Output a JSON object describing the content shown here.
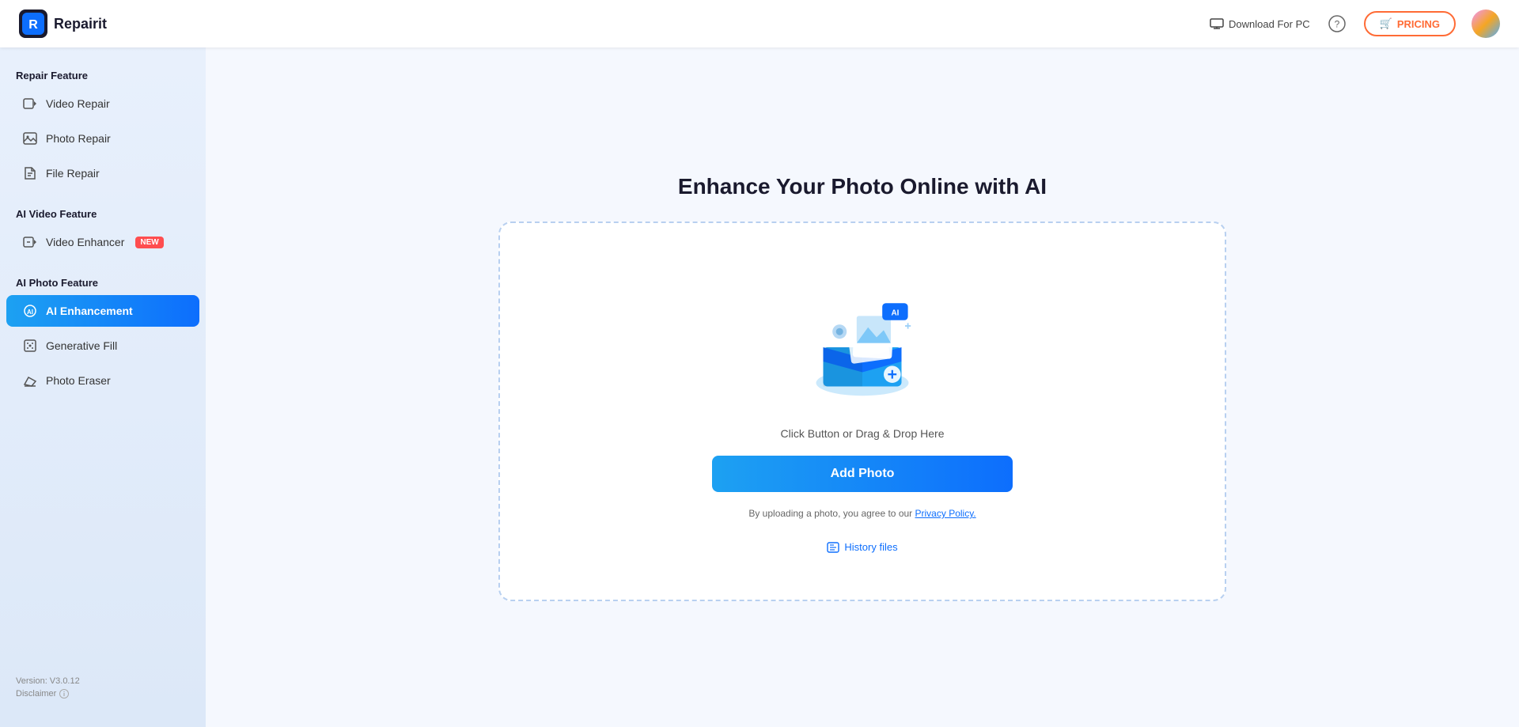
{
  "header": {
    "logo_text": "Repairit",
    "download_label": "Download For PC",
    "pricing_label": "PRICING",
    "pricing_icon": "🛒"
  },
  "sidebar": {
    "repair_feature_label": "Repair Feature",
    "items_repair": [
      {
        "id": "video-repair",
        "label": "Video Repair",
        "icon": "video"
      },
      {
        "id": "photo-repair",
        "label": "Photo Repair",
        "icon": "photo"
      },
      {
        "id": "file-repair",
        "label": "File Repair",
        "icon": "file"
      }
    ],
    "ai_video_label": "AI Video Feature",
    "items_ai_video": [
      {
        "id": "video-enhancer",
        "label": "Video Enhancer",
        "icon": "enhance",
        "badge": "NEW"
      }
    ],
    "ai_photo_label": "AI Photo Feature",
    "items_ai_photo": [
      {
        "id": "ai-enhancement",
        "label": "AI Enhancement",
        "icon": "ai",
        "active": true
      },
      {
        "id": "generative-fill",
        "label": "Generative Fill",
        "icon": "generative"
      },
      {
        "id": "photo-eraser",
        "label": "Photo Eraser",
        "icon": "eraser"
      }
    ],
    "footer": {
      "version": "Version: V3.0.12",
      "disclaimer": "Disclaimer"
    }
  },
  "main": {
    "title": "Enhance Your Photo Online with AI",
    "drag_drop_text": "Click Button or Drag & Drop Here",
    "add_photo_label": "Add Photo",
    "privacy_text": "By uploading a photo, you agree to our",
    "privacy_link": "Privacy Policy.",
    "history_label": "History files"
  }
}
